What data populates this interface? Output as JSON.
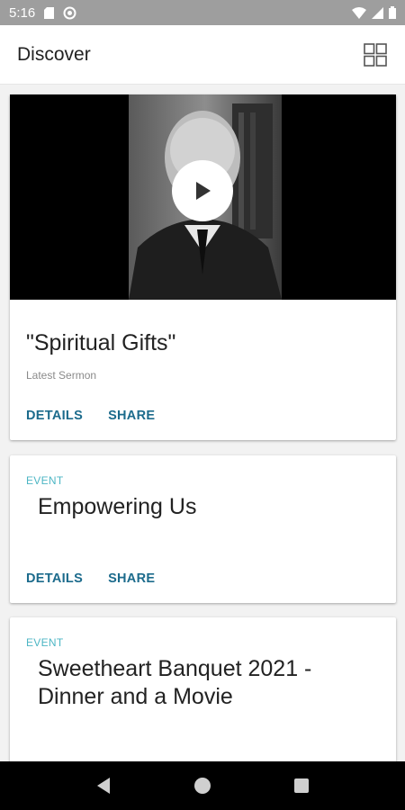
{
  "status_bar": {
    "time": "5:16",
    "icons": [
      "sd-card-icon",
      "sync-icon",
      "wifi-icon",
      "signal-icon",
      "battery-icon"
    ]
  },
  "app_bar": {
    "title": "Discover",
    "grid_icon": "grid-view-icon"
  },
  "cards": [
    {
      "title": "\"Spiritual Gifts\"",
      "subtitle": "Latest Sermon",
      "media_icon": "play-icon",
      "actions": [
        "DETAILS",
        "SHARE"
      ]
    },
    {
      "label": "EVENT",
      "title": "Empowering Us",
      "actions": [
        "DETAILS",
        "SHARE"
      ]
    },
    {
      "label": "EVENT",
      "title": "Sweetheart Banquet 2021 - Dinner and a Movie"
    }
  ],
  "colors": {
    "action": "#1c6b8c",
    "event_label": "#4db6c4",
    "status_bar": "#9e9e9e"
  },
  "nav_bar": {
    "icons": [
      "back-icon",
      "home-icon",
      "recents-icon"
    ]
  }
}
